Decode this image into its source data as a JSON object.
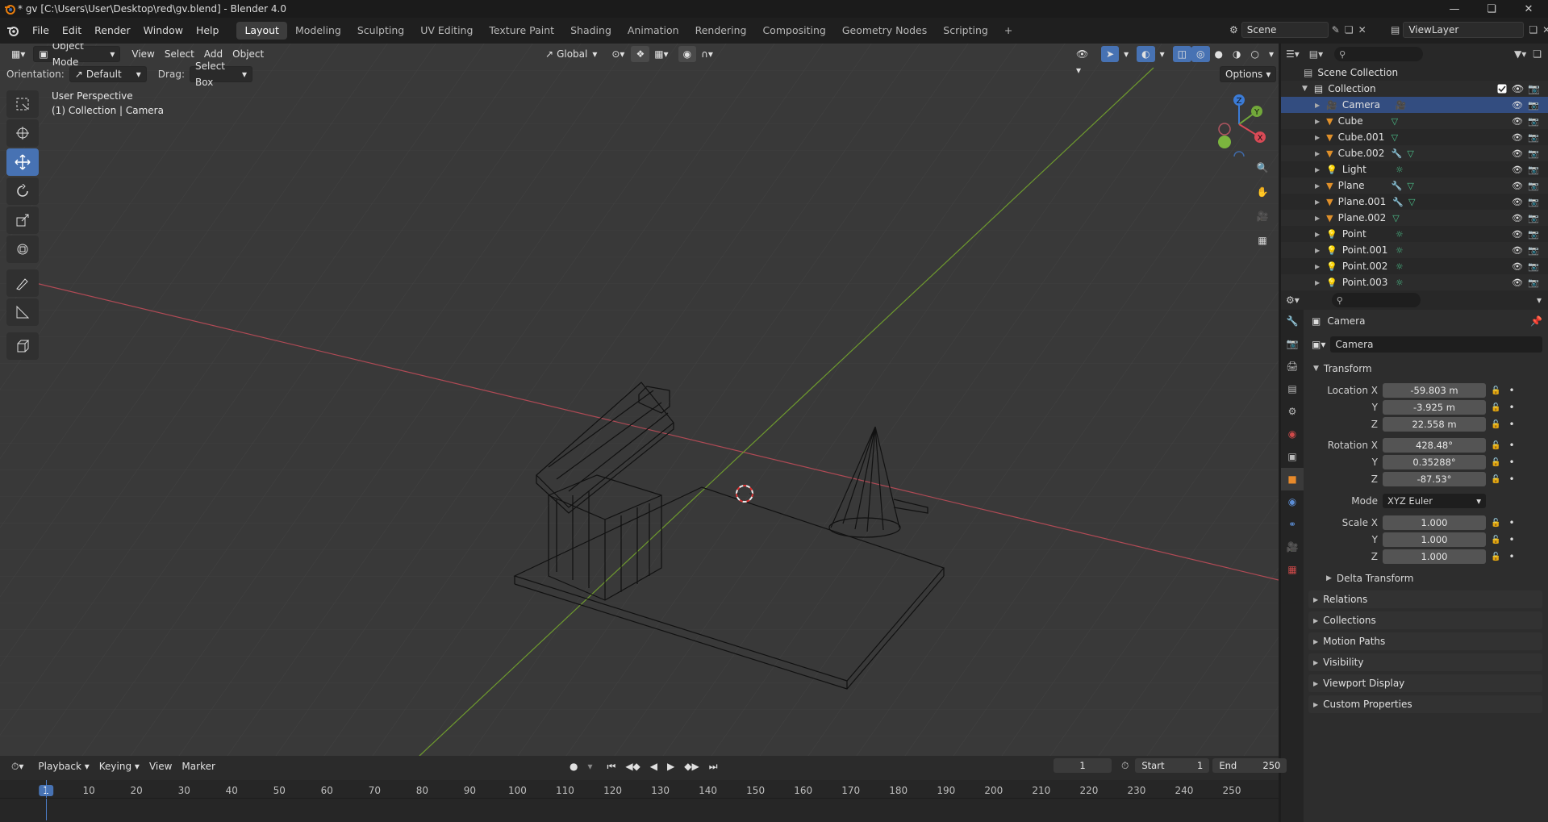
{
  "window": {
    "title": "* gv [C:\\Users\\User\\Desktop\\red\\gv.blend] - Blender 4.0"
  },
  "menubar": {
    "items": [
      "File",
      "Edit",
      "Render",
      "Window",
      "Help"
    ],
    "workspaces": [
      "Layout",
      "Modeling",
      "Sculpting",
      "UV Editing",
      "Texture Paint",
      "Shading",
      "Animation",
      "Rendering",
      "Compositing",
      "Geometry Nodes",
      "Scripting"
    ],
    "active_workspace": "Layout",
    "scene": "Scene",
    "view_layer": "ViewLayer"
  },
  "viewport": {
    "mode": "Object Mode",
    "menus": [
      "View",
      "Select",
      "Add",
      "Object"
    ],
    "transform_orientation": "Global",
    "orientation_label": "Orientation:",
    "orientation_value": "Default",
    "drag_label": "Drag:",
    "drag_value": "Select Box",
    "options_label": "Options",
    "overlay_line1": "User Perspective",
    "overlay_line2": "(1) Collection | Camera",
    "gizmo": {
      "z": "Z",
      "y": "Y",
      "x": "X"
    }
  },
  "outliner": {
    "root": "Scene Collection",
    "collection": "Collection",
    "items": [
      {
        "name": "Camera",
        "icon": "camera-icon",
        "extra": [
          "camera-data-icon"
        ]
      },
      {
        "name": "Cube",
        "icon": "mesh-icon",
        "extra": [
          "mesh-data-icon"
        ]
      },
      {
        "name": "Cube.001",
        "icon": "mesh-icon",
        "extra": [
          "mesh-data-icon"
        ]
      },
      {
        "name": "Cube.002",
        "icon": "mesh-icon",
        "extra": [
          "modifier-icon",
          "mesh-data-icon"
        ]
      },
      {
        "name": "Light",
        "icon": "light-icon",
        "extra": [
          "light-data-icon"
        ]
      },
      {
        "name": "Plane",
        "icon": "mesh-icon",
        "extra": [
          "modifier-icon",
          "mesh-data-icon"
        ]
      },
      {
        "name": "Plane.001",
        "icon": "mesh-icon",
        "extra": [
          "modifier-icon",
          "mesh-data-icon"
        ]
      },
      {
        "name": "Plane.002",
        "icon": "mesh-icon",
        "extra": [
          "mesh-data-icon"
        ]
      },
      {
        "name": "Point",
        "icon": "light-icon",
        "extra": [
          "light-data-icon"
        ]
      },
      {
        "name": "Point.001",
        "icon": "light-icon",
        "extra": [
          "light-data-icon"
        ]
      },
      {
        "name": "Point.002",
        "icon": "light-icon",
        "extra": [
          "light-data-icon"
        ]
      },
      {
        "name": "Point.003",
        "icon": "light-icon",
        "extra": [
          "light-data-icon"
        ]
      }
    ]
  },
  "properties": {
    "object_name": "Camera",
    "object_name_field": "Camera",
    "transform_label": "Transform",
    "location": {
      "label": "Location X",
      "x": "-59.803 m",
      "y": "-3.925 m",
      "z": "22.558 m"
    },
    "rotation": {
      "label": "Rotation X",
      "x": "428.48°",
      "y": "0.35288°",
      "z": "-87.53°"
    },
    "mode_label": "Mode",
    "mode_value": "XYZ Euler",
    "scale": {
      "label": "Scale X",
      "x": "1.000",
      "y": "1.000",
      "z": "1.000"
    },
    "axis_y": "Y",
    "axis_z": "Z",
    "delta": "Delta Transform",
    "panels": [
      "Relations",
      "Collections",
      "Motion Paths",
      "Visibility",
      "Viewport Display",
      "Custom Properties"
    ]
  },
  "timeline": {
    "menus": [
      "Playback",
      "Keying",
      "View",
      "Marker"
    ],
    "current_frame": "1",
    "start_label": "Start",
    "start": "1",
    "end_label": "End",
    "end": "250",
    "ruler": [
      "1",
      "10",
      "20",
      "30",
      "40",
      "50",
      "60",
      "70",
      "80",
      "90",
      "100",
      "110",
      "120",
      "130",
      "140",
      "150",
      "160",
      "170",
      "180",
      "190",
      "200",
      "210",
      "220",
      "230",
      "240",
      "250"
    ]
  }
}
